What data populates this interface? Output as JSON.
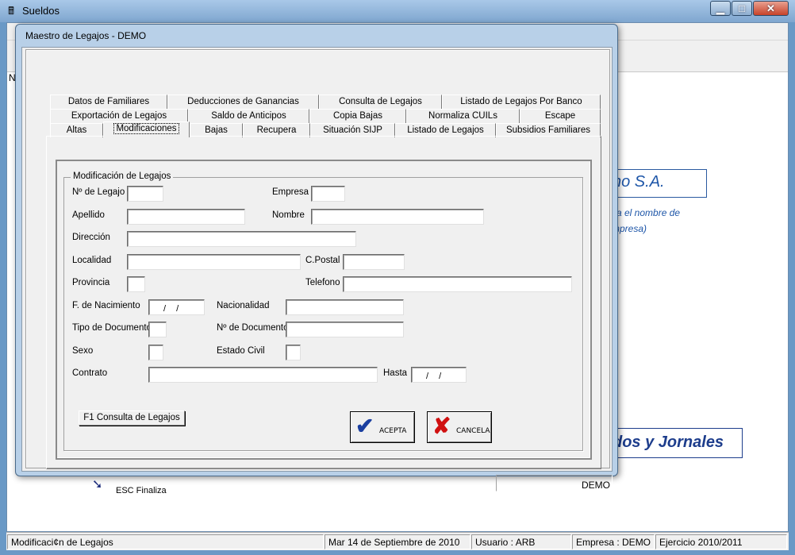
{
  "app": {
    "title": "Sueldos",
    "icon": "app-icon",
    "window_controls": {
      "minimize": "▁",
      "maximize": "□",
      "close": "✕"
    }
  },
  "background": {
    "n_label": "N",
    "company_box": "no S.A.",
    "note_line1": "va el nombre de",
    "note_line2": "mpresa)",
    "product_box": "dos y Jornales"
  },
  "dialog": {
    "title": "Maestro de Legajos  - DEMO",
    "tabs_row1": [
      "Datos de Familiares",
      "Deducciones de Ganancias",
      "Consulta de Legajos",
      "Listado de Legajos Por Banco"
    ],
    "tabs_row2": [
      "Exportación de Legajos",
      "Saldo de Anticipos",
      "Copia Bajas",
      "Normaliza CUILs",
      "Escape"
    ],
    "tabs_row3": [
      "Altas",
      "Modificaciones",
      "Bajas",
      "Recupera",
      "Situación SIJP",
      "Listado de Legajos",
      "Subsidios Familiares"
    ],
    "selected_tab": "Modificaciones",
    "group_title": "Modificación de Legajos",
    "fields": {
      "legajo": {
        "label": "Nº de Legajo",
        "value": ""
      },
      "empresa": {
        "label": "Empresa",
        "value": ""
      },
      "apellido": {
        "label": "Apellido",
        "value": ""
      },
      "nombre": {
        "label": "Nombre",
        "value": ""
      },
      "direccion": {
        "label": "Dirección",
        "value": ""
      },
      "localidad": {
        "label": "Localidad",
        "value": ""
      },
      "cpostal": {
        "label": "C.Postal",
        "value": ""
      },
      "provincia": {
        "label": "Provincia",
        "value": ""
      },
      "telefono": {
        "label": "Telefono",
        "value": ""
      },
      "nacimiento": {
        "label": "F. de Nacimiento",
        "value": "/ /"
      },
      "nacionalidad": {
        "label": "Nacionalidad",
        "value": ""
      },
      "tipo_doc": {
        "label": "Tipo de Documento",
        "value": ""
      },
      "nro_doc": {
        "label": "Nº de Documento",
        "value": ""
      },
      "sexo": {
        "label": "Sexo",
        "value": ""
      },
      "estado_civil": {
        "label": "Estado Civil",
        "value": ""
      },
      "contrato": {
        "label": "Contrato",
        "value": ""
      },
      "hasta": {
        "label": "Hasta",
        "value": "/ /"
      }
    },
    "f1_button": "F1  Consulta de Legajos",
    "acepta": "ACEPTA",
    "cancela": "CANCELA",
    "esc_label": "ESC Finaliza",
    "demo_status": "DEMO"
  },
  "statusbar": {
    "message": "Modificaci¢n de Legajos",
    "date": "Mar 14 de Septiembre de 2010",
    "usuario": "Usuario : ARB",
    "empresa": "Empresa : DEMO",
    "ejercicio": "Ejercicio 2010/2011"
  },
  "colors": {
    "accent": "#1e56a8",
    "title_bar": "#7fa6cf",
    "dialog_frame": "#b8d0e8"
  }
}
